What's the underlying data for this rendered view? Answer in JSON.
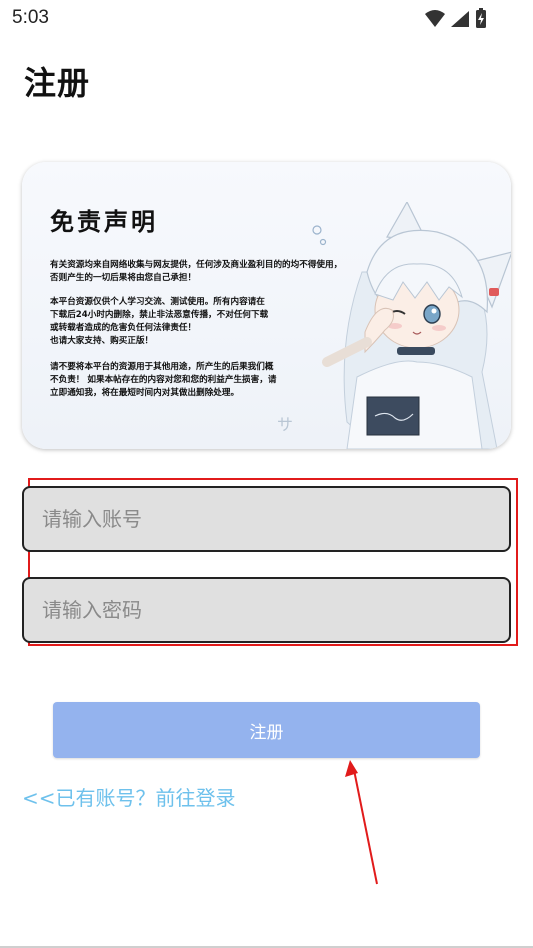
{
  "status_bar": {
    "time": "5:03"
  },
  "page": {
    "title": "注册"
  },
  "disclaimer": {
    "title": "免责声明",
    "paragraph1": "有关资源均来自网络收集与网友提供，任何涉及商业盈利目的的均不得使用，\n否则产生的一切后果将由您自己承担！",
    "paragraph2": "本平台资源仅供个人学习交流、测试使用。所有内容请在\n下载后24小时内删除，禁止非法恶意传播，不对任何下载\n或转载者造成的危害负任何法律责任！\n也请大家支持、购买正版！",
    "paragraph3": "请不要将本平台的资源用于其他用途，所产生的后果我们概\n不负责！ 如果本帖存在的内容对您和您的利益产生损害，请\n立即通知我，将在最短时间内对其做出删除处理。"
  },
  "form": {
    "account_placeholder": "请输入账号",
    "password_placeholder": "请输入密码",
    "register_label": "注册",
    "login_link": "<<已有账号？前往登录"
  },
  "colors": {
    "register_button": "#94b3ee",
    "login_link": "#6ec1ec",
    "annotation": "#e11b1b"
  },
  "icons": [
    "wifi-icon",
    "cell-signal-icon",
    "battery-charging-icon",
    "illustration-anime-girl"
  ]
}
